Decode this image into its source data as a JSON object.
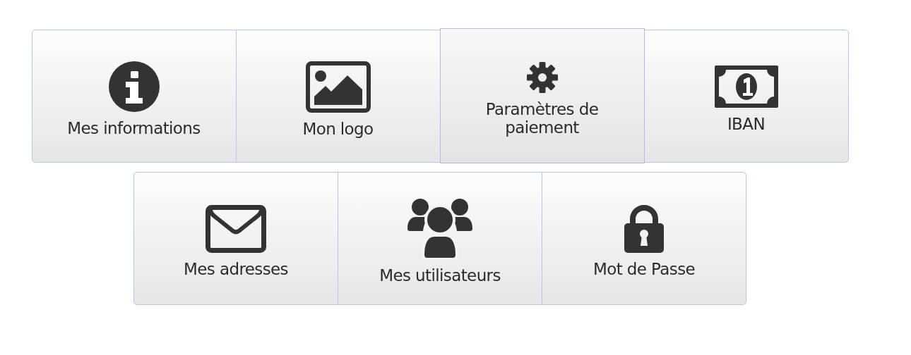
{
  "rows": [
    {
      "tiles": [
        {
          "kind": "info",
          "label": "Mes informations",
          "selected": false
        },
        {
          "kind": "image",
          "label": "Mon logo",
          "selected": false
        },
        {
          "kind": "gear",
          "label": "Paramètres de paiement",
          "selected": true
        },
        {
          "kind": "banknote",
          "label": "IBAN",
          "selected": false
        }
      ]
    },
    {
      "tiles": [
        {
          "kind": "envelope",
          "label": "Mes adresses",
          "selected": false
        },
        {
          "kind": "users",
          "label": "Mes utilisateurs",
          "selected": false
        },
        {
          "kind": "lock",
          "label": "Mot de Passe",
          "selected": false
        }
      ]
    }
  ]
}
